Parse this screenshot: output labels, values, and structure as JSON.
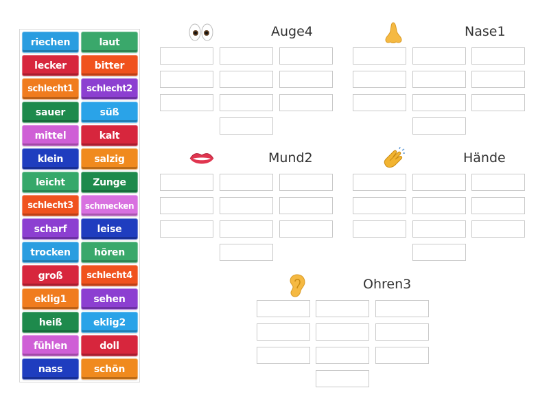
{
  "tiles": [
    {
      "label": "riechen",
      "color": "#2a9de0"
    },
    {
      "label": "laut",
      "color": "#3aa86b"
    },
    {
      "label": "lecker",
      "color": "#d7263d"
    },
    {
      "label": "bitter",
      "color": "#f0521e"
    },
    {
      "label": "schlecht1",
      "color": "#f07c1e"
    },
    {
      "label": "schlecht2",
      "color": "#8c3fd1"
    },
    {
      "label": "sauer",
      "color": "#1e8a4c"
    },
    {
      "label": "süß",
      "color": "#2aa3e8"
    },
    {
      "label": "mittel",
      "color": "#cf5fd6"
    },
    {
      "label": "kalt",
      "color": "#d7263d"
    },
    {
      "label": "klein",
      "color": "#1f3dbf"
    },
    {
      "label": "salzig",
      "color": "#f08a1e"
    },
    {
      "label": "leicht",
      "color": "#36a86a"
    },
    {
      "label": "Zunge",
      "color": "#1e8a4c"
    },
    {
      "label": "schlecht3",
      "color": "#f0521e"
    },
    {
      "label": "schmecken",
      "color": "#d870e0"
    },
    {
      "label": "scharf",
      "color": "#8c3fd1"
    },
    {
      "label": "leise",
      "color": "#1f3dbf"
    },
    {
      "label": "trocken",
      "color": "#2a9de0"
    },
    {
      "label": "hören",
      "color": "#3aa86b"
    },
    {
      "label": "groß",
      "color": "#d7263d"
    },
    {
      "label": "schlecht4",
      "color": "#f0521e"
    },
    {
      "label": "eklig1",
      "color": "#f07c1e"
    },
    {
      "label": "sehen",
      "color": "#8c3fd1"
    },
    {
      "label": "heiß",
      "color": "#1e8a4c"
    },
    {
      "label": "eklig2",
      "color": "#2aa3e8"
    },
    {
      "label": "fühlen",
      "color": "#cf5fd6"
    },
    {
      "label": "doll",
      "color": "#d7263d"
    },
    {
      "label": "nass",
      "color": "#1f3dbf"
    },
    {
      "label": "schön",
      "color": "#f08a1e"
    }
  ],
  "groups": [
    {
      "title": "Auge4",
      "icon": "eyes-icon"
    },
    {
      "title": "Nase1",
      "icon": "nose-icon"
    },
    {
      "title": "Mund2",
      "icon": "mouth-icon"
    },
    {
      "title": "Hände",
      "icon": "clapping-hands-icon"
    },
    {
      "title": "Ohren3",
      "icon": "ear-icon"
    }
  ]
}
